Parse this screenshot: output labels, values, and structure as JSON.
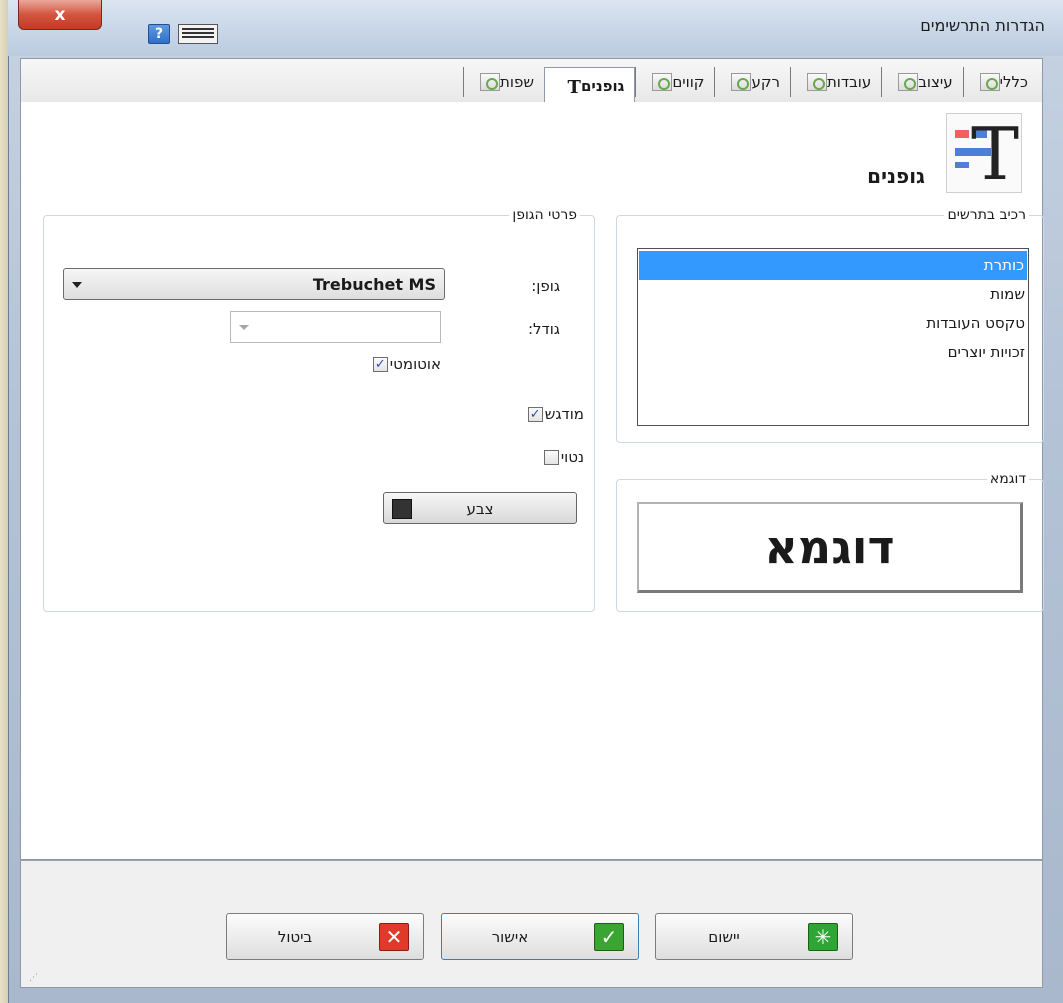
{
  "window": {
    "title": "הגדרות התרשימים",
    "close_label": "x",
    "help_label": "?"
  },
  "tabs": [
    {
      "label": "כללי",
      "icon": "settings-icon",
      "active": false
    },
    {
      "label": "עיצוב",
      "icon": "design-icon",
      "active": false
    },
    {
      "label": "עובדות",
      "icon": "facts-icon",
      "active": false
    },
    {
      "label": "רקע",
      "icon": "background-icon",
      "active": false
    },
    {
      "label": "קווים",
      "icon": "lines-icon",
      "active": false
    },
    {
      "label": "גופנים",
      "icon": "font-icon",
      "active": true
    },
    {
      "label": "שפות",
      "icon": "languages-icon",
      "active": false
    }
  ],
  "page": {
    "title": "גופנים"
  },
  "component_group": {
    "label": "רכיב בתרשים",
    "items": [
      "כותרת",
      "שמות",
      "טקסט העובדות",
      "זכויות יוצרים"
    ],
    "selected_index": 0
  },
  "sample_group": {
    "label": "דוגמא",
    "sample_text": "דוגמא"
  },
  "font_details": {
    "label": "פרטי הגופן",
    "font_label": "גופן:",
    "font_value": "Trebuchet MS",
    "size_label": "גודל:",
    "size_value": "",
    "auto_label": "אוטומטי",
    "auto_checked": true,
    "bold_label": "מודגש",
    "bold_checked": true,
    "italic_label": "נטוי",
    "italic_checked": false,
    "color_label": "צבע",
    "color_value": "#333333"
  },
  "buttons": {
    "cancel": "ביטול",
    "ok": "אישור",
    "apply": "יישום"
  },
  "colors": {
    "selection": "#3399ff",
    "cancel_icon": "#e03a2a",
    "ok_icon": "#3aa530",
    "apply_icon": "#2fa535"
  }
}
